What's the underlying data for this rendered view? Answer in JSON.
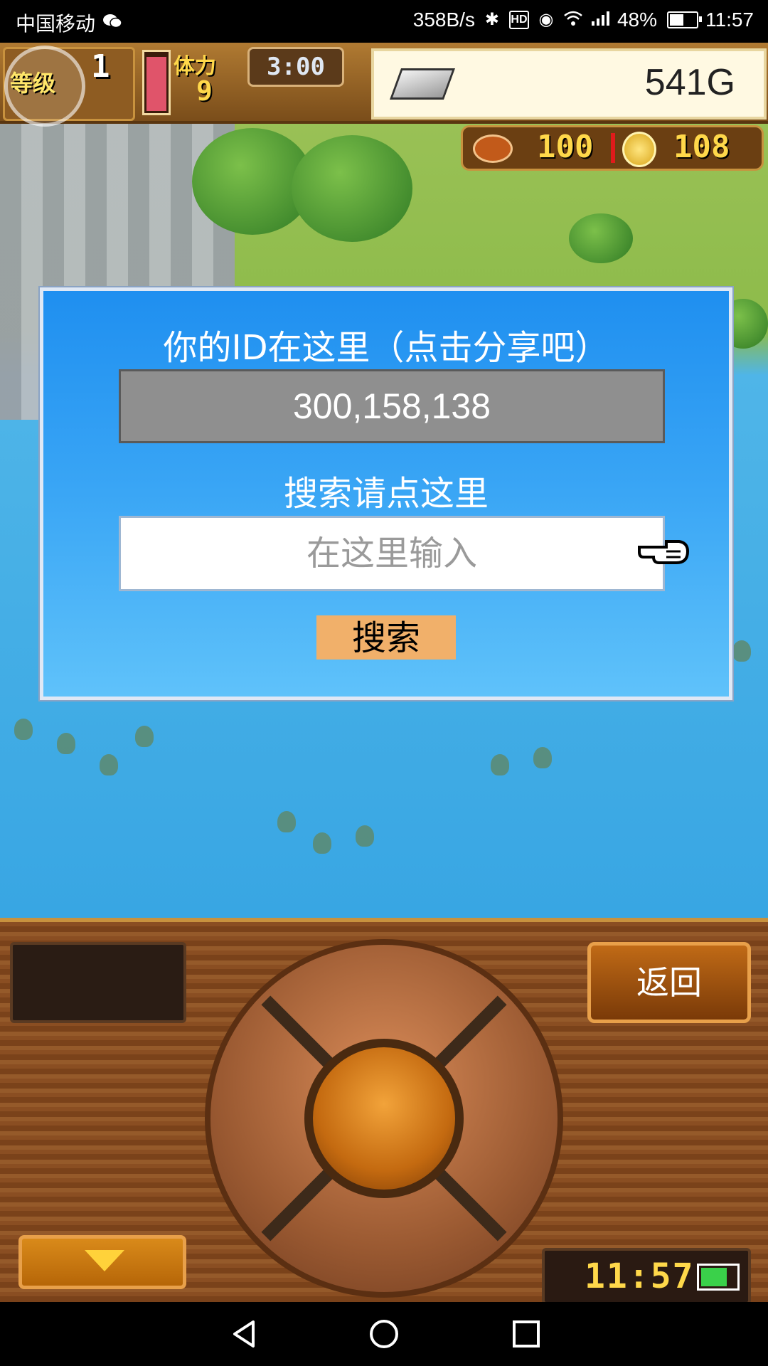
{
  "status_bar": {
    "carrier": "中国移动",
    "net_speed": "358B/s",
    "battery_percent": "48%",
    "time": "11:57",
    "icons": [
      "wechat-icon",
      "bluetooth-icon",
      "hd-icon",
      "eye-icon",
      "wifi-icon",
      "signal-icon",
      "battery-icon"
    ]
  },
  "hud": {
    "level_label": "等级",
    "level_value": "1",
    "stamina_label": "体力",
    "stamina_value": "9",
    "timer": "3:00",
    "gold": "541G",
    "meat": "100",
    "coins": "108"
  },
  "dialog": {
    "title": "你的ID在这里（点击分享吧）",
    "player_id": "300,158,138",
    "search_label": "搜索请点这里",
    "input_placeholder": "在这里输入",
    "search_button": "搜索"
  },
  "panel": {
    "back_button": "返回",
    "clock": "11:57"
  },
  "colors": {
    "dialog_top": "#1f8ff0",
    "dialog_bottom": "#5fc2fa",
    "search_button": "#f1b06a",
    "id_box": "#8f8f8f",
    "wood": "#8a4e22"
  }
}
